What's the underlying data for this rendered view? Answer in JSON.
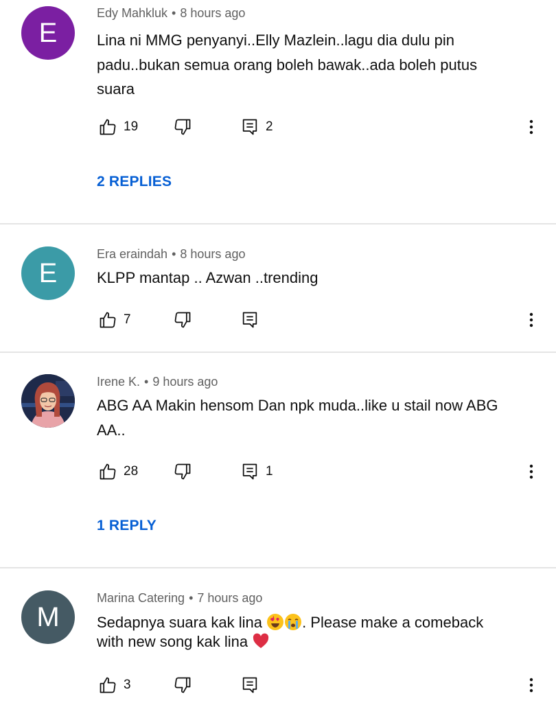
{
  "comments": [
    {
      "author": "Edy Mahkluk",
      "time": "8 hours ago",
      "avatar_letter": "E",
      "avatar_color": "#7b1fa2",
      "lines": [
        "Lina ni MMG penyanyi..Elly Mazlein..lagu dia dulu pin",
        "padu..bukan semua orang boleh bawak..ada boleh putus",
        "suara"
      ],
      "likes": "19",
      "reply_count": "2",
      "replies_label": "2 REPLIES"
    },
    {
      "author": "Era eraindah",
      "time": "8 hours ago",
      "avatar_letter": "E",
      "avatar_color": "#3b9ba7",
      "text": "KLPP mantap .. Azwan ..trending",
      "likes": "7"
    },
    {
      "author": "Irene K.",
      "time": "9 hours ago",
      "lines": [
        "ABG AA Makin hensom Dan npk muda..like u  stail now ABG",
        "AA.."
      ],
      "likes": "28",
      "reply_count": "1",
      "replies_label": "1 REPLY"
    },
    {
      "author": "Marina Catering",
      "time": "7 hours ago",
      "avatar_letter": "M",
      "avatar_color": "#455a64",
      "text_a": "Sedapnya suara kak lina ",
      "text_b": ". Please make a comeback",
      "text_c": "with new song kak lina ",
      "likes": "3"
    }
  ],
  "icons": {
    "like": "thumbs-up-icon",
    "dislike": "thumbs-down-icon",
    "reply": "reply-comment-icon",
    "more": "more-vertical-icon"
  }
}
